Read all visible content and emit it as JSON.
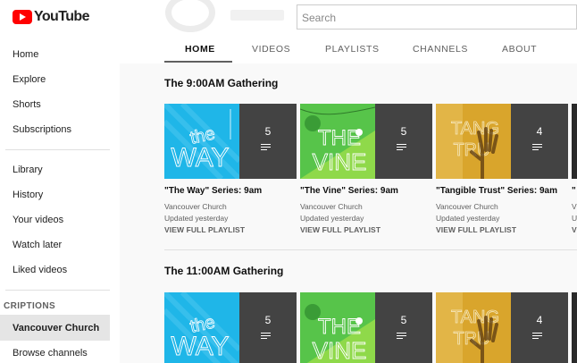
{
  "app": {
    "name": "YouTube",
    "brand_color": "#ff0000"
  },
  "sidebar": {
    "main_items": [
      {
        "label": "Home"
      },
      {
        "label": "Explore"
      },
      {
        "label": "Shorts"
      },
      {
        "label": "Subscriptions"
      }
    ],
    "library_items": [
      {
        "label": "Library"
      },
      {
        "label": "History"
      },
      {
        "label": "Your videos"
      },
      {
        "label": "Watch later"
      },
      {
        "label": "Liked videos"
      }
    ],
    "subscriptions_title": "CRIPTIONS",
    "subscriptions": [
      {
        "label": "Vancouver Church",
        "selected": true
      },
      {
        "label": "Browse channels"
      }
    ]
  },
  "search": {
    "placeholder": "Search"
  },
  "tabs": [
    {
      "label": "HOME",
      "active": true
    },
    {
      "label": "VIDEOS"
    },
    {
      "label": "PLAYLISTS"
    },
    {
      "label": "CHANNELS"
    },
    {
      "label": "ABOUT"
    }
  ],
  "sections": [
    {
      "title": "The 9:00AM Gathering",
      "playlists": [
        {
          "title": "\"The Way\" Series: 9am",
          "channel": "Vancouver Church",
          "updated": "Updated yesterday",
          "link": "VIEW FULL PLAYLIST",
          "count": "5",
          "art": "the-way",
          "accent": "#1fb6e8"
        },
        {
          "title": "\"The Vine\" Series: 9am",
          "channel": "Vancouver Church",
          "updated": "Updated yesterday",
          "link": "VIEW FULL PLAYLIST",
          "count": "5",
          "art": "the-vine",
          "accent": "#57c44a"
        },
        {
          "title": "\"Tangible Trust\" Series: 9am",
          "channel": "Vancouver Church",
          "updated": "Updated yesterday",
          "link": "VIEW FULL PLAYLIST",
          "count": "4",
          "art": "tangible-trust",
          "accent": "#d9a52c"
        },
        {
          "title": "\"",
          "channel": "V",
          "updated": "U",
          "link": "V",
          "count": "",
          "art": "partial",
          "accent": "#333"
        }
      ]
    },
    {
      "title": "The 11:00AM Gathering",
      "playlists": [
        {
          "count": "5",
          "art": "the-way",
          "accent": "#1fb6e8"
        },
        {
          "count": "5",
          "art": "the-vine",
          "accent": "#57c44a"
        },
        {
          "count": "4",
          "art": "tangible-trust",
          "accent": "#d9a52c"
        }
      ]
    }
  ]
}
